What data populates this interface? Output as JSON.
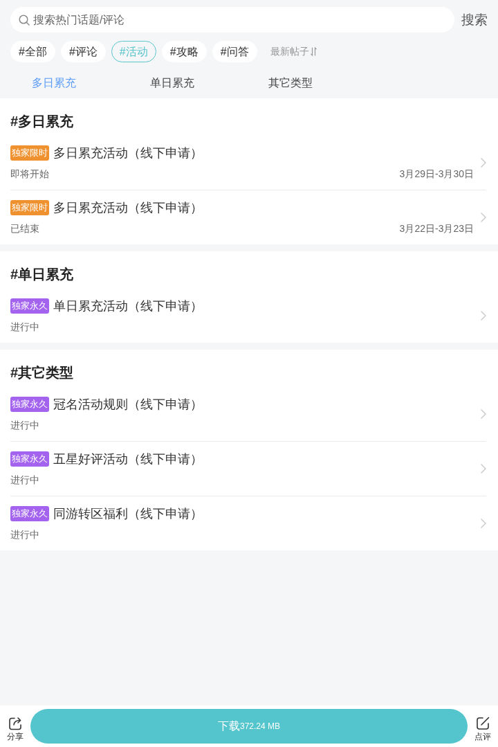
{
  "search": {
    "placeholder": "搜索热门话题/评论",
    "button": "搜索"
  },
  "filters": [
    {
      "label": "#全部",
      "selected": false
    },
    {
      "label": "#评论",
      "selected": false
    },
    {
      "label": "#活动",
      "selected": true
    },
    {
      "label": "#攻略",
      "selected": false
    },
    {
      "label": "#问答",
      "selected": false
    }
  ],
  "sort": {
    "label": "最新帖子"
  },
  "tabs": [
    {
      "label": "多日累充",
      "selected": true
    },
    {
      "label": "单日累充",
      "selected": false
    },
    {
      "label": "其它类型",
      "selected": false
    }
  ],
  "sections": [
    {
      "title": "#多日累充",
      "items": [
        {
          "badge": {
            "text": "独家限时",
            "color": "#f0912f"
          },
          "title": "多日累充活动（线下申请）",
          "status": "即将开始",
          "date": "3月29日-3月30日"
        },
        {
          "badge": {
            "text": "独家限时",
            "color": "#f0912f"
          },
          "title": "多日累充活动（线下申请）",
          "status": "已结束",
          "date": "3月22日-3月23日"
        }
      ]
    },
    {
      "title": "#单日累充",
      "items": [
        {
          "badge": {
            "text": "独家永久",
            "color": "#a463ee"
          },
          "title": "单日累充活动（线下申请）",
          "status": "进行中"
        }
      ]
    },
    {
      "title": "#其它类型",
      "items": [
        {
          "badge": {
            "text": "独家永久",
            "color": "#a463ee"
          },
          "title": "冠名活动规则（线下申请）",
          "status": "进行中"
        },
        {
          "badge": {
            "text": "独家永久",
            "color": "#a463ee"
          },
          "title": "五星好评活动（线下申请）",
          "status": "进行中"
        },
        {
          "badge": {
            "text": "独家永久",
            "color": "#a463ee"
          },
          "title": "同游转区福利（线下申请）",
          "status": "进行中"
        }
      ]
    }
  ],
  "bottom_bar": {
    "share": "分享",
    "download": {
      "label": "下载",
      "size": "372.24 MB"
    },
    "review": "点评"
  }
}
